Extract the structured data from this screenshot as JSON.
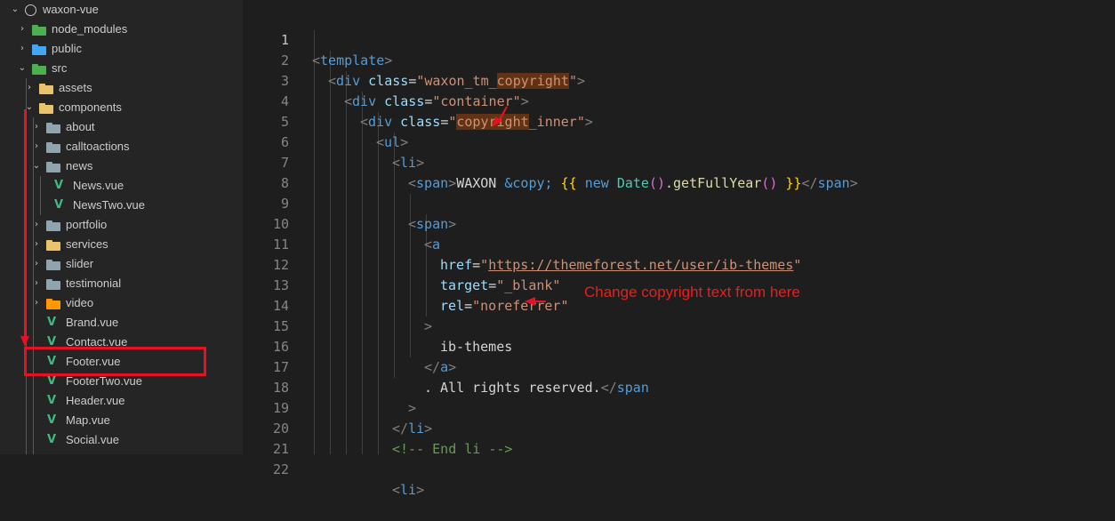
{
  "explorer": {
    "items": [
      {
        "label": "waxon-vue",
        "kind": "root"
      },
      {
        "label": "node_modules",
        "kind": "folder",
        "color": "green"
      },
      {
        "label": "public",
        "kind": "folder",
        "color": "blue"
      },
      {
        "label": "src",
        "kind": "folder",
        "color": "green"
      },
      {
        "label": "assets",
        "kind": "folder",
        "color": "yellow"
      },
      {
        "label": "components",
        "kind": "folder",
        "color": "yellow"
      },
      {
        "label": "about",
        "kind": "folder",
        "color": "grey"
      },
      {
        "label": "calltoactions",
        "kind": "folder",
        "color": "grey"
      },
      {
        "label": "news",
        "kind": "folder",
        "color": "grey"
      },
      {
        "label": "News.vue",
        "kind": "vue"
      },
      {
        "label": "NewsTwo.vue",
        "kind": "vue"
      },
      {
        "label": "portfolio",
        "kind": "folder",
        "color": "grey"
      },
      {
        "label": "services",
        "kind": "folder",
        "color": "yellow"
      },
      {
        "label": "slider",
        "kind": "folder",
        "color": "grey"
      },
      {
        "label": "testimonial",
        "kind": "folder",
        "color": "grey"
      },
      {
        "label": "video",
        "kind": "folder",
        "color": "orange"
      },
      {
        "label": "Brand.vue",
        "kind": "vue"
      },
      {
        "label": "Contact.vue",
        "kind": "vue"
      },
      {
        "label": "Footer.vue",
        "kind": "vue"
      },
      {
        "label": "FooterTwo.vue",
        "kind": "vue"
      },
      {
        "label": "Header.vue",
        "kind": "vue"
      },
      {
        "label": "Map.vue",
        "kind": "vue"
      },
      {
        "label": "Social.vue",
        "kind": "vue"
      }
    ]
  },
  "editor": {
    "line_numbers": [
      "1",
      "2",
      "3",
      "4",
      "5",
      "6",
      "7",
      "8",
      "9",
      "10",
      "11",
      "12",
      "13",
      "14",
      "15",
      "16",
      "17",
      "18",
      "19",
      "20",
      "21",
      "22"
    ],
    "active_line": "1",
    "annotation": "Change copyright text from here",
    "code": {
      "l1": {
        "open": "<",
        "tag": "template",
        "close": ">"
      },
      "l2": {
        "open": "<",
        "tag": "div",
        "attr": "class",
        "eq": "=",
        "q1": "\"",
        "v1": "waxon_tm_",
        "v2": "copyright",
        "q2": "\"",
        "close": ">"
      },
      "l3": {
        "open": "<",
        "tag": "div",
        "attr": "class",
        "eq": "=",
        "val": "\"container\"",
        "close": ">"
      },
      "l4": {
        "open": "<",
        "tag": "div",
        "attr": "class",
        "eq": "=",
        "q1": "\"",
        "v1": "copyright",
        "v2": "_inner",
        "q2": "\"",
        "close": ">"
      },
      "l5": {
        "open": "<",
        "tag": "ul",
        "close": ">"
      },
      "l6": {
        "open": "<",
        "tag": "li",
        "close": ">"
      },
      "l7": {
        "open": "<",
        "tag": "span",
        "close": ">",
        "text": "WAXON ",
        "entity": "&copy;",
        "sp": " ",
        "ob": "{{",
        "sp2": " ",
        "kw": "new",
        "sp3": " ",
        "cls": "Date",
        "p1": "()",
        "dot": ".",
        "fn": "getFullYear",
        "p2": "()",
        "sp4": " ",
        "cb": "}}",
        "open2": "</",
        "tag2": "span",
        "close2": ">"
      },
      "l9": {
        "open": "<",
        "tag": "span",
        "close": ">"
      },
      "l10": {
        "open": "<",
        "tag": "a"
      },
      "l11": {
        "attr": "href",
        "eq": "=",
        "q1": "\"",
        "val": "https://themeforest.net/user/ib-themes",
        "q2": "\""
      },
      "l12": {
        "attr": "target",
        "eq": "=",
        "val": "\"_blank\""
      },
      "l13": {
        "attr": "rel",
        "eq": "=",
        "val": "\"noreferrer\""
      },
      "l14": {
        "close": ">"
      },
      "l15": {
        "text": "ib-themes"
      },
      "l16": {
        "open": "</",
        "tag": "a",
        "close": ">"
      },
      "l17": {
        "text": ". All rights reserved.",
        "open": "</",
        "tag": "span"
      },
      "l18": {
        "close": ">"
      },
      "l19": {
        "open": "</",
        "tag": "li",
        "close": ">"
      },
      "l20": {
        "comment": "<!-- End li -->"
      },
      "l22": {
        "open": "<",
        "tag": "li",
        "close": ">"
      }
    }
  },
  "colors": {
    "highlight_box": "#e81123",
    "arrow": "#e81123",
    "annotation": "#f01b1b"
  }
}
